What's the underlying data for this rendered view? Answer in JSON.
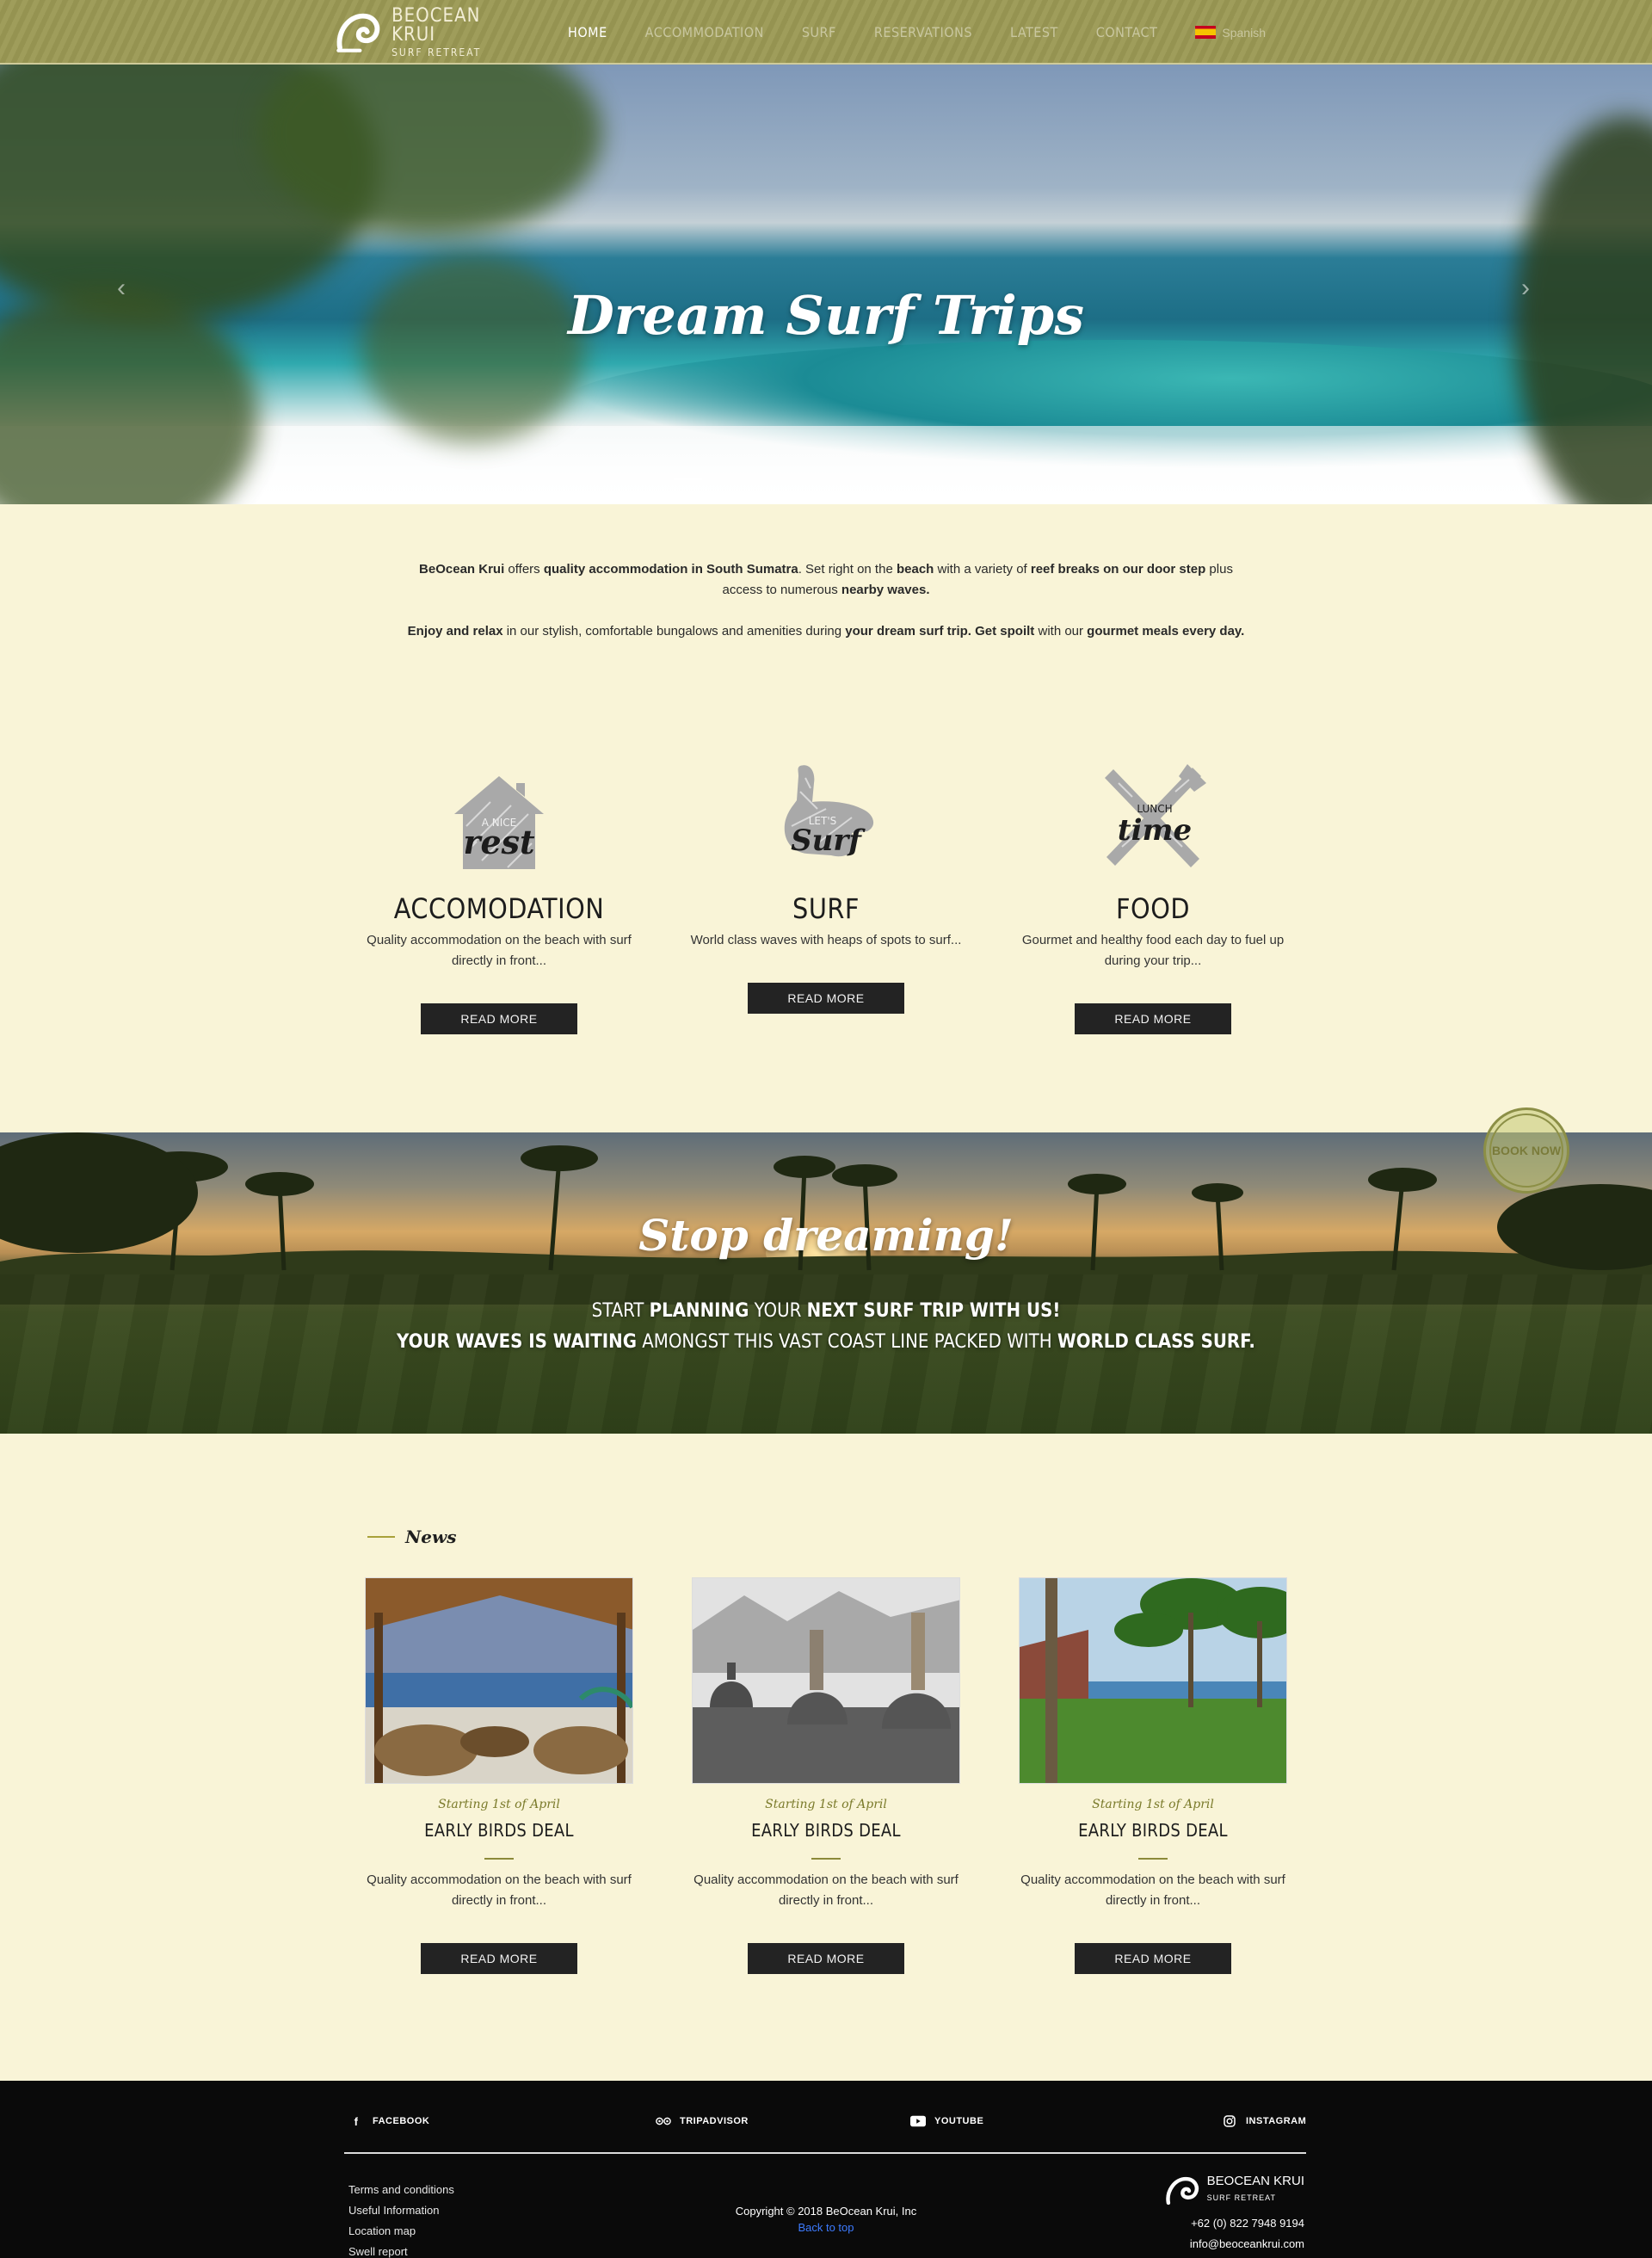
{
  "brand": {
    "name_line1": "BEOCEAN KRUI",
    "name_line2": "SURF RETREAT"
  },
  "nav": {
    "items": [
      "HOME",
      "ACCOMMODATION",
      "SURF",
      "RESERVATIONS",
      "LATEST",
      "CONTACT"
    ],
    "language": "Spanish"
  },
  "hero": {
    "title": "Dream Surf Trips",
    "prev": "‹",
    "next": "›",
    "slides": 10,
    "active_slide": 0
  },
  "intro": {
    "p1": [
      {
        "t": "BeOcean Krui",
        "b": true
      },
      {
        "t": " offers ",
        "b": false
      },
      {
        "t": "quality accommodation in South Sumatra",
        "b": true
      },
      {
        "t": ". Set right on the ",
        "b": false
      },
      {
        "t": "beach",
        "b": true
      },
      {
        "t": " with a variety of ",
        "b": false
      },
      {
        "t": "reef breaks on our door step",
        "b": true
      },
      {
        "t": " plus access to numerous ",
        "b": false
      },
      {
        "t": "nearby waves.",
        "b": true
      }
    ],
    "p2": [
      {
        "t": "Enjoy and relax",
        "b": true
      },
      {
        "t": " in our stylish, comfortable bungalows and amenities during ",
        "b": false
      },
      {
        "t": "your dream surf trip. Get spoilt",
        "b": true
      },
      {
        "t": " with our ",
        "b": false
      },
      {
        "t": "gourmet meals every day.",
        "b": true
      }
    ]
  },
  "features": [
    {
      "art_top": "A NICE",
      "art_word": "rest",
      "title": "ACCOMODATION",
      "text": "Quality accommodation on the beach with surf directly in front...",
      "button": "READ MORE"
    },
    {
      "art_top": "LET'S",
      "art_word": "Surf",
      "title": "SURF",
      "text": "World class waves with heaps of spots to surf...",
      "button": "READ MORE"
    },
    {
      "art_top": "LUNCH",
      "art_word": "time",
      "title": "FOOD",
      "text": "Gourmet and healthy food each day to fuel up during your trip...",
      "button": "READ MORE"
    }
  ],
  "band": {
    "title": "Stop dreaming!",
    "line1": [
      {
        "t": "START ",
        "b": false
      },
      {
        "t": "PLANNING",
        "b": true
      },
      {
        "t": " YOUR ",
        "b": false
      },
      {
        "t": "NEXT SURF TRIP WITH US!",
        "b": true
      }
    ],
    "line2": [
      {
        "t": "YOUR WAVES IS WAITING",
        "b": true
      },
      {
        "t": " AMONGST THIS VAST COAST LINE PACKED WITH ",
        "b": false
      },
      {
        "t": "WORLD CLASS SURF.",
        "b": true
      }
    ],
    "book_now": "BOOK NOW"
  },
  "news": {
    "heading": "News",
    "cards": [
      {
        "date": "Starting 1st of April",
        "title": "EARLY BIRDS DEAL",
        "text": "Quality accommodation on the beach with surf directly in front...",
        "button": "READ MORE"
      },
      {
        "date": "Starting 1st of April",
        "title": "EARLY BIRDS DEAL",
        "text": "Quality accommodation on the beach with surf directly in front...",
        "button": "READ MORE"
      },
      {
        "date": "Starting 1st of April",
        "title": "EARLY BIRDS DEAL",
        "text": "Quality accommodation on the beach with surf directly in front...",
        "button": "READ MORE"
      }
    ]
  },
  "footer": {
    "social": [
      {
        "icon": "facebook-icon",
        "label": "FACEBOOK"
      },
      {
        "icon": "tripadvisor-icon",
        "label": "TRIPADVISOR"
      },
      {
        "icon": "youtube-icon",
        "label": "YOUTUBE"
      },
      {
        "icon": "instagram-icon",
        "label": "INSTAGRAM"
      }
    ],
    "links": [
      "Terms and conditions",
      "Useful Information",
      "Location map",
      "Swell report"
    ],
    "copyright": "Copyright © 2018 BeOcean Krui, Inc",
    "back_to_top": "Back to top",
    "phone": "+62 (0) 822 7948 9194",
    "email": "info@beoceankrui.com"
  },
  "colors": {
    "header_olive": "#9b9954",
    "page_cream": "#f9f4d7",
    "button_dark": "#232323",
    "footer_black": "#0a0a0a",
    "accent_olive": "#8c8a3a"
  }
}
